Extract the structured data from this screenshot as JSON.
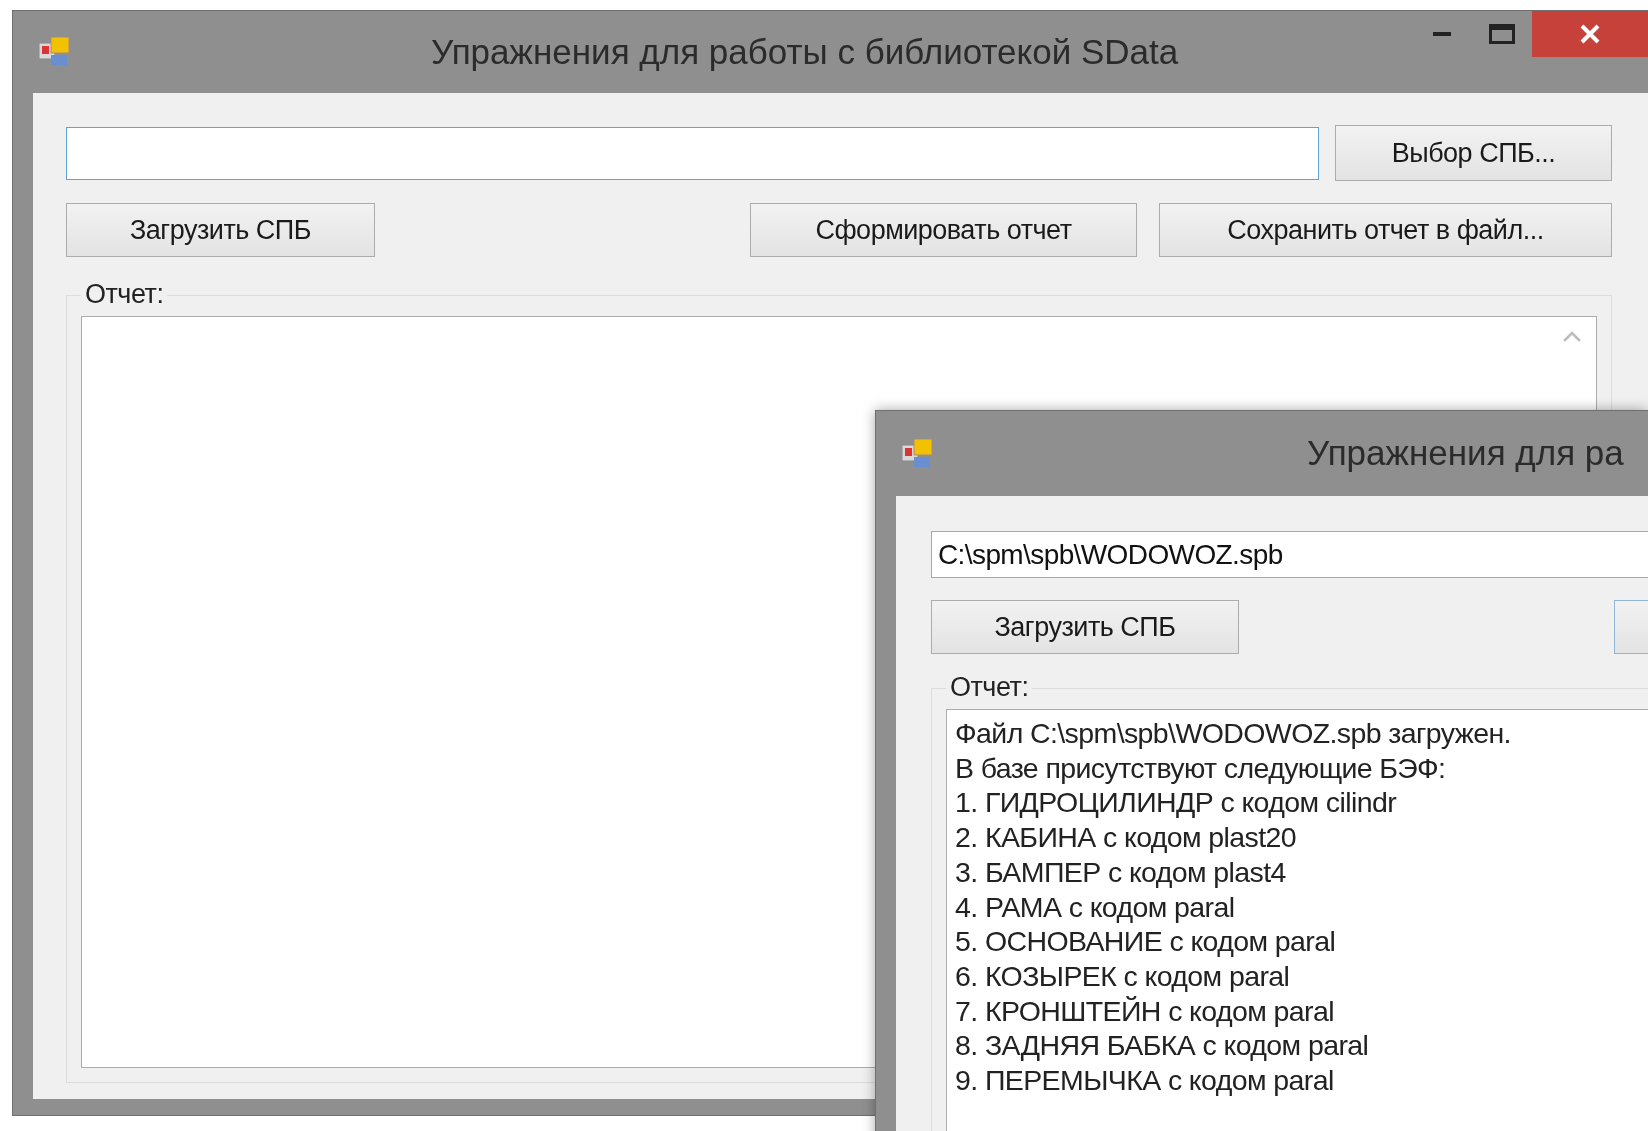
{
  "windows": [
    {
      "title": "Упражнения для работы с библиотекой SData",
      "path_field": {
        "focused": true
      },
      "browse_button": {
        "label": "Выбор СПБ..."
      },
      "buttons": [
        {
          "label": "Загрузить СПБ"
        },
        {
          "label": "Сформировать отчет"
        },
        {
          "label": "Сохранить отчет в файл..."
        }
      ],
      "report": {
        "label": "Отчет:"
      }
    },
    {
      "title": "Упражнения для ра",
      "path_field": {
        "focused": false,
        "value": "C:\\spm\\spb\\WODOWOZ.spb"
      },
      "buttons": [
        {
          "label": "Загрузить СПБ"
        }
      ],
      "report": {
        "label": "Отчет:",
        "lines": [
          "Файл C:\\spm\\spb\\WODOWOZ.spb загружен.",
          "В базе присутствуют следующие БЭФ:",
          "1. ГИДРОЦИЛИНДР с кодом cilindr",
          "2. КАБИНА с кодом plast20",
          "3. БАМПЕР с кодом plast4",
          "4. РАМА с кодом paral",
          "5. ОСНОВАНИЕ с кодом paral",
          "6. КОЗЫРЕК с кодом paral",
          "7. КРОНШТЕЙН с кодом paral",
          "8. ЗАДНЯЯ БАБКА с кодом paral",
          "9. ПЕРЕМЫЧКА с кодом paral"
        ]
      }
    }
  ]
}
